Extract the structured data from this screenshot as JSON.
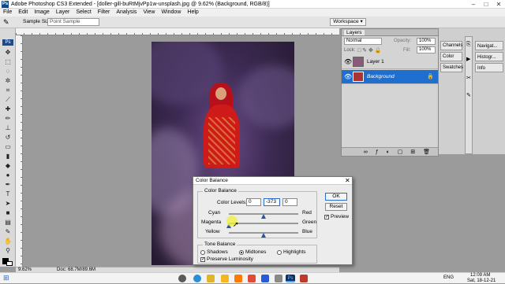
{
  "app": {
    "title": "Adobe Photoshop CS3 Extended - [doller-gill-buRtMjvPp1w-unsplash.jpg @ 9.62% (Background, RGB/8)]",
    "icon_label": "Ps",
    "window_controls": [
      "–",
      "□",
      "✕"
    ]
  },
  "menu": [
    "File",
    "Edit",
    "Image",
    "Layer",
    "Select",
    "Filter",
    "Analysis",
    "View",
    "Window",
    "Help"
  ],
  "options_bar": {
    "sample_size_label": "Sample Size:",
    "sample_size_value": "Point Sample",
    "workspace_label": "Workspace ▾"
  },
  "layers_panel": {
    "tab": "Layers",
    "blend_mode": "Normal",
    "opacity_label": "Opacity:",
    "opacity_value": "100%",
    "lock_label": "Lock:",
    "fill_label": "Fill:",
    "fill_value": "100%",
    "layers": [
      {
        "name": "Layer 1",
        "selected": false
      },
      {
        "name": "Background",
        "selected": true
      }
    ]
  },
  "right_dock": {
    "col1": [
      "Channels",
      "Color",
      "Swatches"
    ],
    "col2": [
      "Navigat...",
      "Histogr...",
      "Info"
    ]
  },
  "status": {
    "zoom": "9.62%",
    "doc": "Doc: 68.7M/89.6M"
  },
  "color_balance": {
    "title": "Color Balance",
    "section_color": "Color Balance",
    "levels_label": "Color Levels:",
    "levels": [
      "0",
      "-373",
      "0"
    ],
    "sliders": [
      {
        "left": "Cyan",
        "right": "Red",
        "value": 0
      },
      {
        "left": "Magenta",
        "right": "Green",
        "value": -100
      },
      {
        "left": "Yellow",
        "right": "Blue",
        "value": 0
      }
    ],
    "section_tone": "Tone Balance",
    "tones": [
      "Shadows",
      "Midtones",
      "Highlights"
    ],
    "selected_tone": "Midtones",
    "preserve_luminosity": "Preserve Luminosity",
    "ok": "OK",
    "reset": "Reset",
    "preview": "Preview"
  },
  "taskbar": {
    "lang": "ENG",
    "time": "12:09 AM",
    "date": "Sat, 18-12-21"
  }
}
